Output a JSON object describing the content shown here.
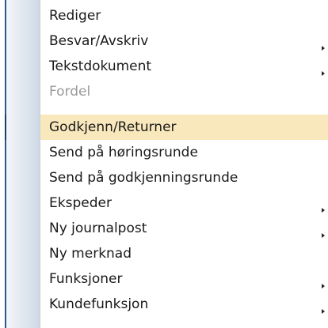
{
  "menu": {
    "items": [
      {
        "label": "Rediger",
        "submenu": false,
        "disabled": false,
        "highlighted": false
      },
      {
        "label": "Besvar/Avskriv",
        "submenu": true,
        "disabled": false,
        "highlighted": false
      },
      {
        "label": "Tekstdokument",
        "submenu": true,
        "disabled": false,
        "highlighted": false
      },
      {
        "label": "Fordel",
        "submenu": false,
        "disabled": true,
        "highlighted": false
      },
      {
        "label": "Godkjenn/Returner",
        "submenu": false,
        "disabled": false,
        "highlighted": true
      },
      {
        "label": "Send på høringsrunde",
        "submenu": false,
        "disabled": false,
        "highlighted": false
      },
      {
        "label": "Send på godkjenningsrunde",
        "submenu": false,
        "disabled": false,
        "highlighted": false
      },
      {
        "label": "Ekspeder",
        "submenu": true,
        "disabled": false,
        "highlighted": false
      },
      {
        "label": "Ny journalpost",
        "submenu": true,
        "disabled": false,
        "highlighted": false
      },
      {
        "label": "Ny merknad",
        "submenu": false,
        "disabled": false,
        "highlighted": false
      },
      {
        "label": "Funksjoner",
        "submenu": true,
        "disabled": false,
        "highlighted": false
      },
      {
        "label": "Kundefunksjon",
        "submenu": true,
        "disabled": false,
        "highlighted": false
      }
    ],
    "colors": {
      "highlight": "#fae8bd",
      "disabled_text": "#9a9a9a",
      "border": "#2b5a8a"
    },
    "icons": {
      "submenu_arrow": "submenu-arrow-icon"
    }
  }
}
